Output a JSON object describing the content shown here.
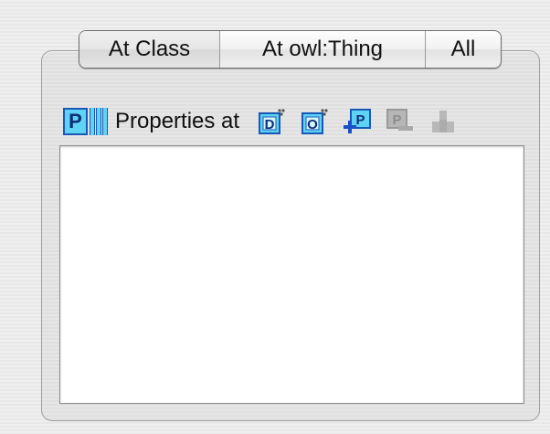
{
  "tabs": [
    {
      "label": "At Class",
      "active": true
    },
    {
      "label": "At owl:Thing",
      "active": false
    },
    {
      "label": "All",
      "active": false
    }
  ],
  "header": {
    "icon_letter": "P",
    "label": "Properties at",
    "tools": [
      {
        "name": "datatype-property-icon",
        "letter": "D",
        "enabled": true
      },
      {
        "name": "object-property-icon",
        "letter": "O",
        "enabled": true
      },
      {
        "name": "add-property-icon",
        "letter": "P",
        "enabled": true
      },
      {
        "name": "remove-property-icon",
        "letter": "P",
        "enabled": false
      },
      {
        "name": "property-hierarchy-icon",
        "letter": "",
        "enabled": false
      }
    ]
  },
  "colors": {
    "icon_fill": "#5fd3f3",
    "icon_border": "#1a58b8",
    "disabled": "#a9a9a9",
    "add_cross": "#1b4fc9"
  },
  "properties_list": []
}
